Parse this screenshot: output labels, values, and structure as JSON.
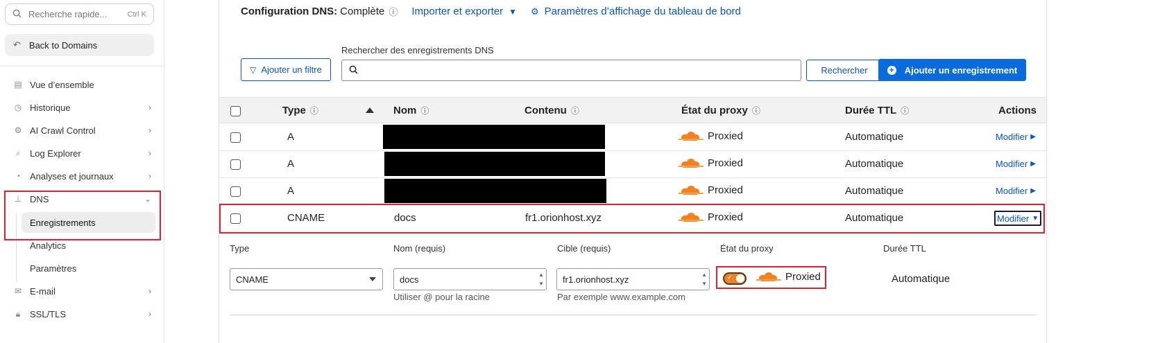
{
  "sidebar": {
    "search_placeholder": "Recherche rapide...",
    "search_shortcut": "Ctrl K",
    "back_label": "Back to Domains",
    "items": [
      {
        "label": "Vue d’ensemble",
        "icon": "document-icon"
      },
      {
        "label": "Historique",
        "icon": "history-icon"
      },
      {
        "label": "AI Crawl Control",
        "icon": "bot-icon"
      },
      {
        "label": "Log Explorer",
        "icon": "log-icon"
      },
      {
        "label": "Analyses et journaux",
        "icon": "chart-icon"
      },
      {
        "label": "DNS",
        "icon": "network-icon"
      },
      {
        "label": "E-mail",
        "icon": "mail-icon"
      },
      {
        "label": "SSL/TLS",
        "icon": "lock-icon"
      }
    ],
    "dns_sub_items": [
      "Enregistrements",
      "Analytics",
      "Paramètres"
    ]
  },
  "header": {
    "config_label": "Configuration DNS:",
    "config_value": "Complète",
    "import_export": "Importer et exporter",
    "dashboard_settings": "Paramètres d’affichage du tableau de bord"
  },
  "toolbar": {
    "filter_label": "Ajouter un filtre",
    "search_label": "Rechercher des enregistrements DNS",
    "search_button": "Rechercher",
    "add_button": "Ajouter un enregistrement"
  },
  "table": {
    "columns": [
      "Type",
      "Nom",
      "Contenu",
      "État du proxy",
      "Durée TTL",
      "Actions"
    ],
    "rows": [
      {
        "type": "A",
        "name": "",
        "content": "",
        "proxy": "Proxied",
        "ttl": "Automatique",
        "action": "Modifier"
      },
      {
        "type": "A",
        "name": "",
        "content": "",
        "proxy": "Proxied",
        "ttl": "Automatique",
        "action": "Modifier"
      },
      {
        "type": "A",
        "name": "",
        "content": "",
        "proxy": "Proxied",
        "ttl": "Automatique",
        "action": "Modifier"
      },
      {
        "type": "CNAME",
        "name": "docs",
        "content": "fr1.orionhost.xyz",
        "proxy": "Proxied",
        "ttl": "Automatique",
        "action": "Modifier"
      }
    ]
  },
  "edit_form": {
    "type_label": "Type",
    "type_value": "CNAME",
    "name_label": "Nom (requis)",
    "name_value": "docs",
    "name_help": "Utiliser @ pour la racine",
    "target_label": "Cible (requis)",
    "target_value": "fr1.orionhost.xyz",
    "target_help": "Par exemple www.example.com",
    "proxy_label": "État du proxy",
    "proxy_value": "Proxied",
    "proxy_enabled": true,
    "ttl_label": "Durée TTL",
    "ttl_value": "Automatique"
  },
  "colors": {
    "accent": "#0a55c8",
    "primary_button": "#0a6bdc",
    "cloudflare_orange": "#f48120",
    "highlight": "#e0202f"
  }
}
